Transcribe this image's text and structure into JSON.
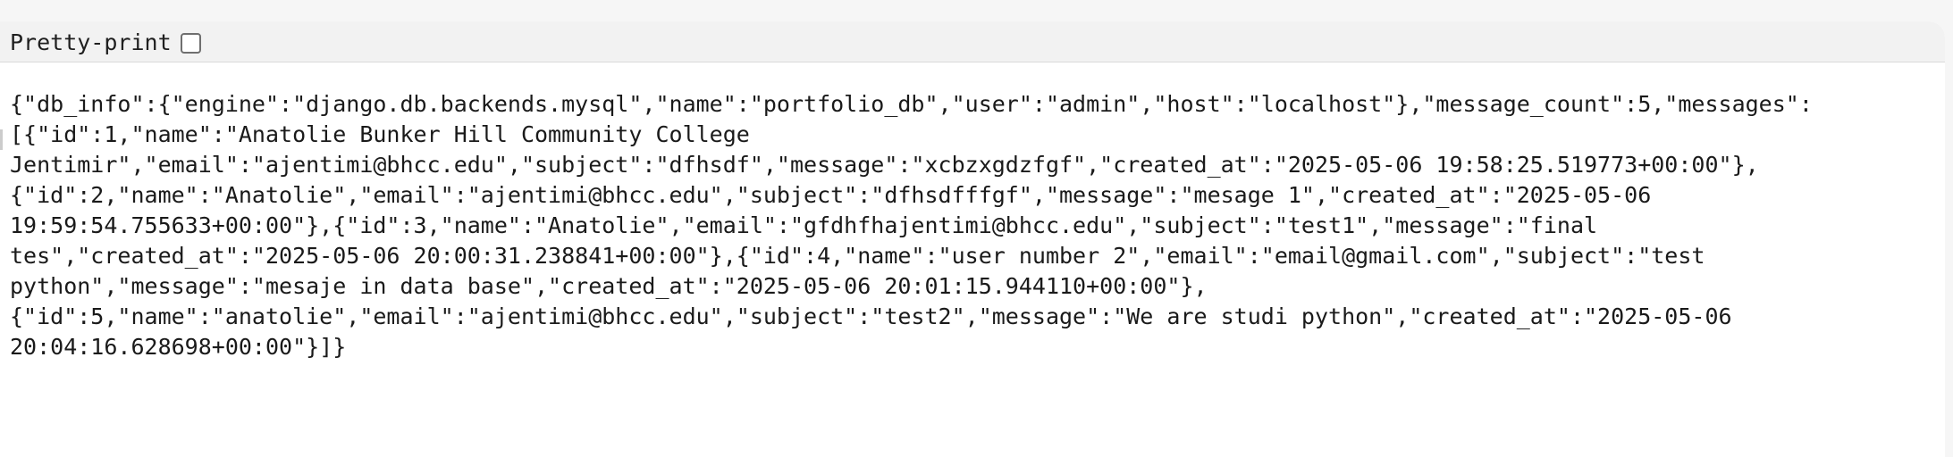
{
  "toolbar": {
    "pretty_print_label": "Pretty-print",
    "pretty_print_checked": false
  },
  "json_lines": [
    "{\"db_info\":{\"engine\":\"django.db.backends.mysql\",\"name\":\"portfolio_db\",\"user\":\"admin\",\"host\":\"localhost\"},\"message_count\":5,\"messages\":",
    "[{\"id\":1,\"name\":\"Anatolie Bunker Hill Community College",
    "Jentimir\",\"email\":\"ajentimi@bhcc.edu\",\"subject\":\"dfhsdf\",\"message\":\"xcbzxgdzfgf\",\"created_at\":\"2025-05-06 19:58:25.519773+00:00\"},",
    "{\"id\":2,\"name\":\"Anatolie\",\"email\":\"ajentimi@bhcc.edu\",\"subject\":\"dfhsdfffgf\",\"message\":\"mesage 1\",\"created_at\":\"2025-05-06",
    "19:59:54.755633+00:00\"},{\"id\":3,\"name\":\"Anatolie\",\"email\":\"gfdhfhajentimi@bhcc.edu\",\"subject\":\"test1\",\"message\":\"final",
    "tes\",\"created_at\":\"2025-05-06 20:00:31.238841+00:00\"},{\"id\":4,\"name\":\"user number 2\",\"email\":\"email@gmail.com\",\"subject\":\"test",
    "python\",\"message\":\"mesaje in data base\",\"created_at\":\"2025-05-06 20:01:15.944110+00:00\"},",
    "{\"id\":5,\"name\":\"anatolie\",\"email\":\"ajentimi@bhcc.edu\",\"subject\":\"test2\",\"message\":\"We are studi python\",\"created_at\":\"2025-05-06",
    "20:04:16.628698+00:00\"}]}"
  ]
}
